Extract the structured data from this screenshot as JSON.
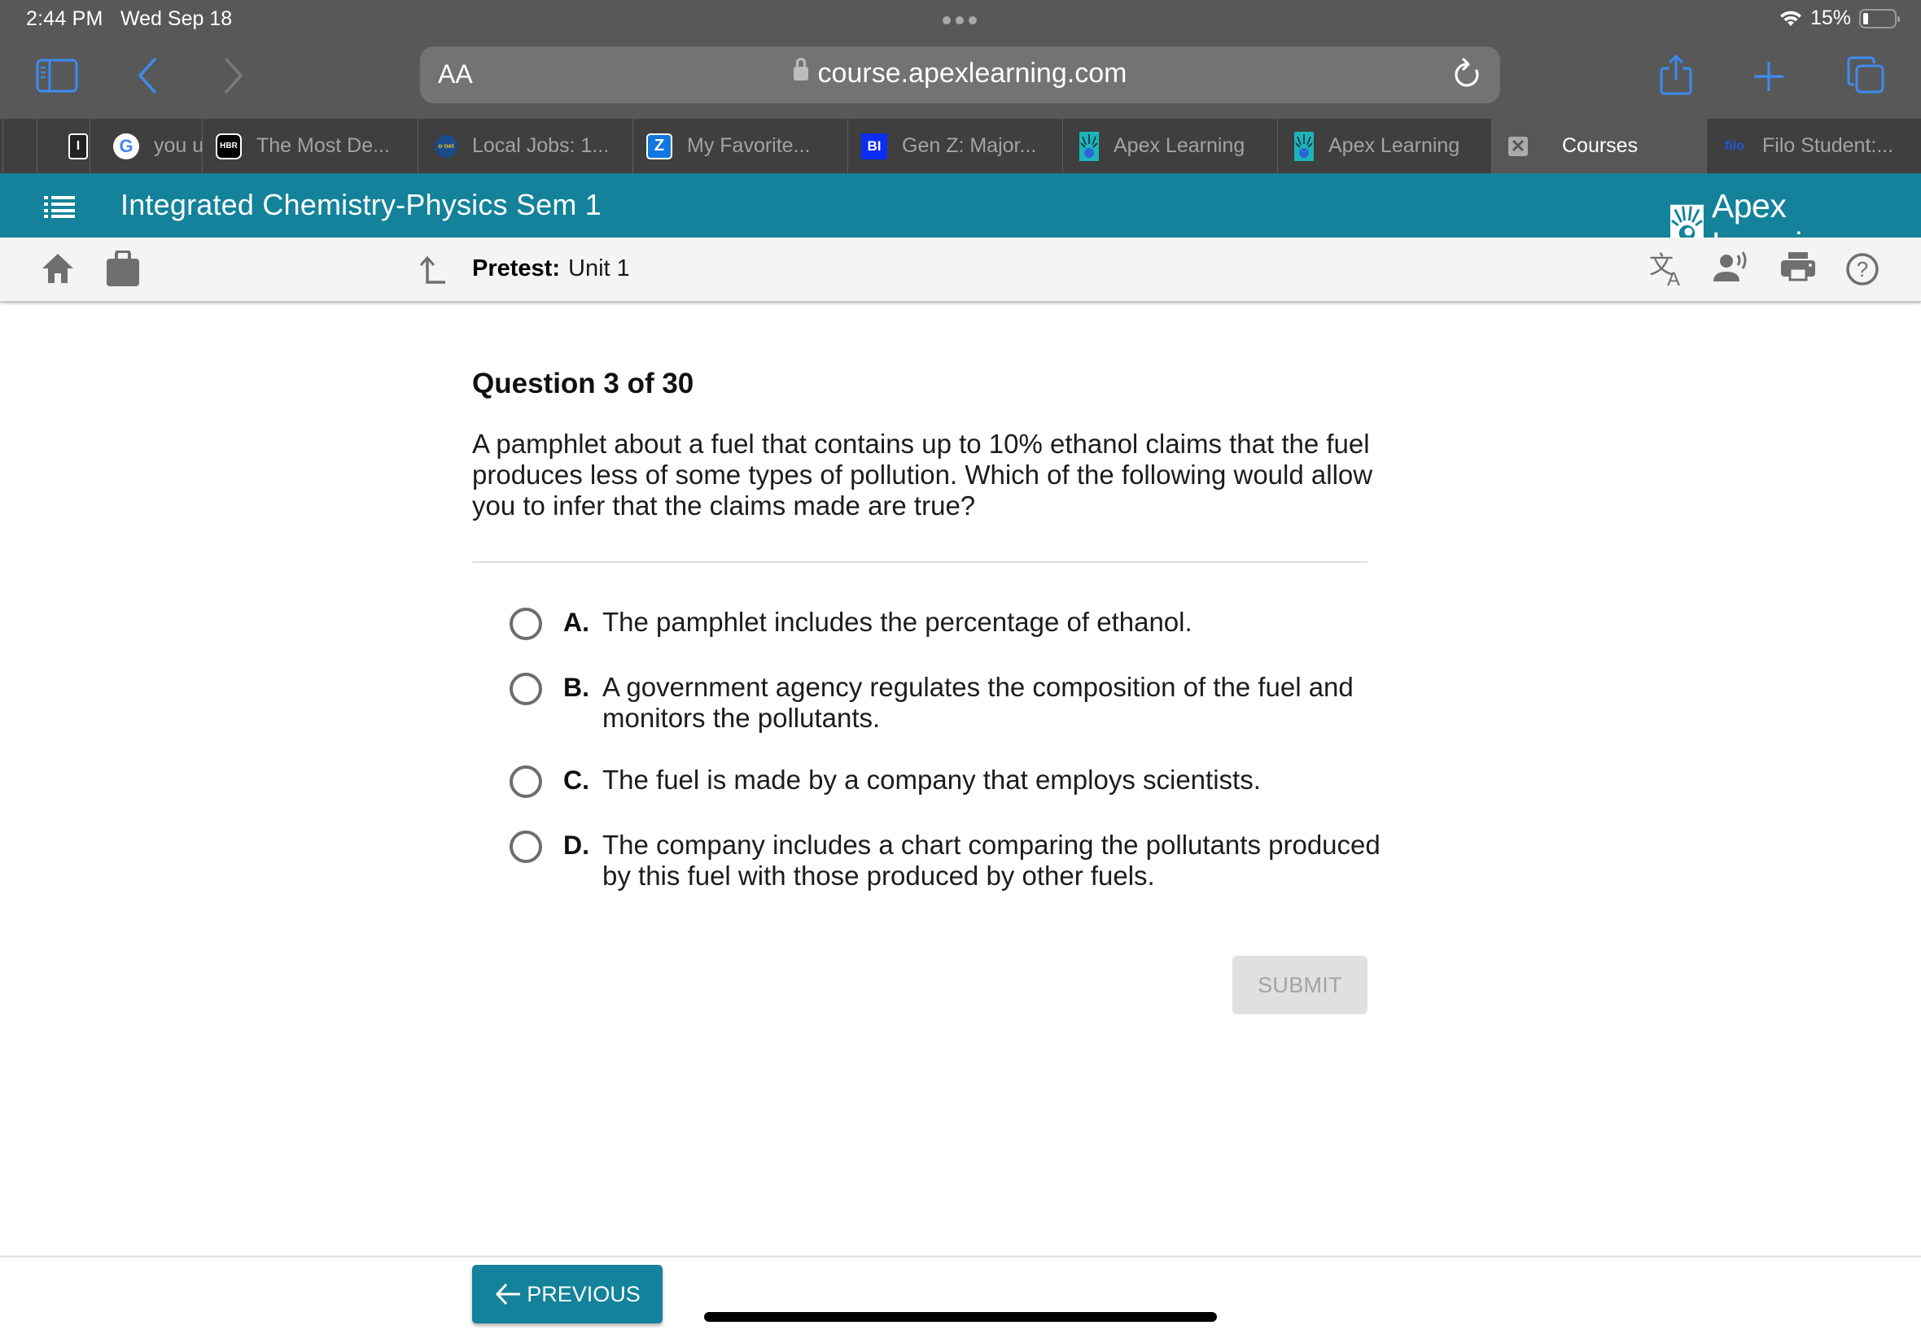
{
  "status_bar": {
    "time": "2:44 PM",
    "date": "Wed Sep 18",
    "battery_percent": "15%",
    "battery_level": 0.15
  },
  "browser": {
    "text_size_label": "AA",
    "url": "course.apexlearning.com",
    "icons": {
      "sidebar": "sidebar-icon",
      "back": "chevron-left-icon",
      "forward": "chevron-right-icon",
      "lock": "lock-icon",
      "reload": "reload-icon",
      "share": "share-icon",
      "new_tab": "plus-icon",
      "tabs": "tabs-overview-icon"
    },
    "tabs": [
      {
        "label": "",
        "favicon": "I"
      },
      {
        "label": "you u",
        "favicon": "G"
      },
      {
        "label": "The Most De...",
        "favicon": "HBR"
      },
      {
        "label": "Local Jobs: 1...",
        "favicon": "o·net"
      },
      {
        "label": "My Favorite...",
        "favicon": "Z"
      },
      {
        "label": "Gen Z: Major...",
        "favicon": "BI"
      },
      {
        "label": "Apex Learning",
        "favicon": "apex"
      },
      {
        "label": "Apex Learning",
        "favicon": "apex"
      },
      {
        "label": "Courses",
        "favicon": "close",
        "active": true
      },
      {
        "label": "Filo Student:...",
        "favicon": "filo"
      }
    ]
  },
  "app": {
    "course_title": "Integrated Chemistry-Physics Sem 1",
    "brand": "Apex Learning",
    "brand_mark": "®",
    "breadcrumb_label": "Pretest:",
    "breadcrumb_value": "Unit 1",
    "colors": {
      "primary": "#13829a",
      "subbar": "#f4f4f4",
      "disabled_button": "#e0e0e0"
    }
  },
  "question": {
    "heading": "Question 3 of 30",
    "text": "A pamphlet about a fuel that contains up to 10% ethanol claims that the fuel produces less of some types of pollution. Which of the following would allow you to infer that the claims made are true?",
    "options": [
      {
        "letter": "A.",
        "text": "The pamphlet includes the percentage of ethanol.",
        "selected": false
      },
      {
        "letter": "B.",
        "text": "A government agency regulates the composition of the fuel and monitors the pollutants.",
        "selected": false
      },
      {
        "letter": "C.",
        "text": "The fuel is made by a company that employs scientists.",
        "selected": false
      },
      {
        "letter": "D.",
        "text": "The company includes a chart comparing the pollutants produced by this fuel with those produced by other fuels.",
        "selected": false
      }
    ],
    "submit_label": "SUBMIT",
    "submit_enabled": false
  },
  "footer": {
    "previous_label": "PREVIOUS"
  }
}
